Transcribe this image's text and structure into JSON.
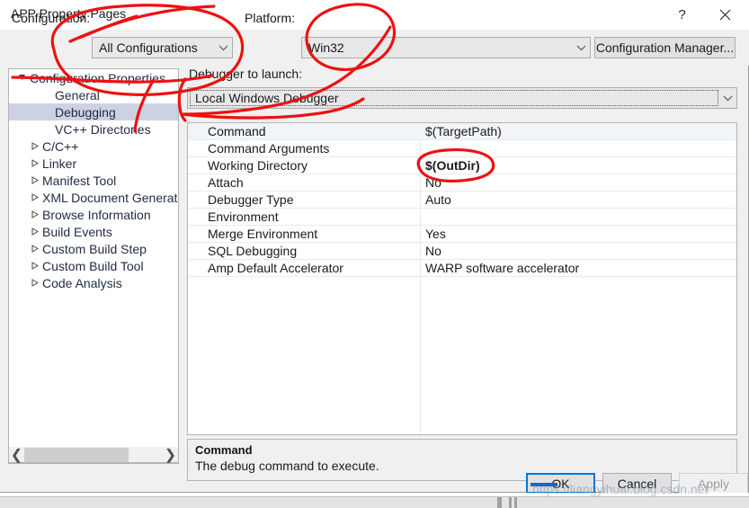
{
  "window": {
    "title": "APP Property Pages",
    "help_label": "?",
    "close_label": "✕",
    "help_icon": "question-mark-icon",
    "close_icon": "close-icon"
  },
  "configbar": {
    "configuration_label": "Configuration:",
    "configuration_value": "All Configurations",
    "platform_label": "Platform:",
    "platform_value": "Win32",
    "configuration_manager_label": "Configuration Manager..."
  },
  "tree": {
    "items": [
      {
        "label": "Configuration Properties",
        "level": "root",
        "expander": "expanded",
        "selected": false
      },
      {
        "label": "General",
        "level": "leaf2",
        "expander": "none",
        "selected": false
      },
      {
        "label": "Debugging",
        "level": "leaf2",
        "expander": "none",
        "selected": true
      },
      {
        "label": "VC++ Directories",
        "level": "leaf2",
        "expander": "none",
        "selected": false
      },
      {
        "label": "C/C++",
        "level": "child",
        "expander": "collapsed",
        "selected": false
      },
      {
        "label": "Linker",
        "level": "child",
        "expander": "collapsed",
        "selected": false
      },
      {
        "label": "Manifest Tool",
        "level": "child",
        "expander": "collapsed",
        "selected": false
      },
      {
        "label": "XML Document Generator",
        "level": "child",
        "expander": "collapsed",
        "selected": false
      },
      {
        "label": "Browse Information",
        "level": "child",
        "expander": "collapsed",
        "selected": false
      },
      {
        "label": "Build Events",
        "level": "child",
        "expander": "collapsed",
        "selected": false
      },
      {
        "label": "Custom Build Step",
        "level": "child",
        "expander": "collapsed",
        "selected": false
      },
      {
        "label": "Custom Build Tool",
        "level": "child",
        "expander": "collapsed",
        "selected": false
      },
      {
        "label": "Code Analysis",
        "level": "child",
        "expander": "collapsed",
        "selected": false
      }
    ],
    "scroll_left_label": "❮",
    "scroll_right_label": "❯"
  },
  "main": {
    "debugger_label": "Debugger to launch:",
    "debugger_value": "Local Windows Debugger",
    "properties": [
      {
        "name": "Command",
        "value": "$(TargetPath)",
        "bold": false
      },
      {
        "name": "Command Arguments",
        "value": "",
        "bold": false
      },
      {
        "name": "Working Directory",
        "value": "$(OutDir)",
        "bold": true
      },
      {
        "name": "Attach",
        "value": "No",
        "bold": false
      },
      {
        "name": "Debugger Type",
        "value": "Auto",
        "bold": false
      },
      {
        "name": "Environment",
        "value": "",
        "bold": false
      },
      {
        "name": "Merge Environment",
        "value": "Yes",
        "bold": false
      },
      {
        "name": "SQL Debugging",
        "value": "No",
        "bold": false
      },
      {
        "name": "Amp Default Accelerator",
        "value": "WARP software accelerator",
        "bold": false
      }
    ]
  },
  "description": {
    "title": "Command",
    "text": "The debug command to execute."
  },
  "footer": {
    "ok_label": "OK",
    "cancel_label": "Cancel",
    "apply_label": "Apply"
  },
  "watermark": {
    "text": "https://liangyihuai.blog.csdn.net"
  },
  "colors": {
    "accent": "#0078d7",
    "ink": "#ee1111",
    "selection": "#cdd2e3",
    "dialog_bg": "#f0f0f0"
  }
}
